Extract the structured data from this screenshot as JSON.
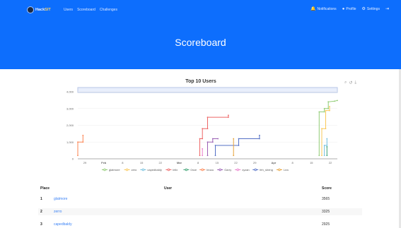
{
  "nav": {
    "brand_main": "Hack",
    "brand_accent": "SIT",
    "links": [
      "Users",
      "Scoreboard",
      "Challenges"
    ],
    "right": [
      {
        "label": "Notifications",
        "icon": "bell-icon"
      },
      {
        "label": "Profile",
        "icon": "user-circle-icon"
      },
      {
        "label": "Settings",
        "icon": "gears-icon"
      },
      {
        "label": "",
        "icon": "logout-icon"
      }
    ]
  },
  "page_title": "Scoreboard",
  "colors": {
    "header_bg": "#0d6efd",
    "link": "#3b82f6"
  },
  "chart_data": {
    "type": "line",
    "title": "Top 10 Users",
    "x_tick_labels": [
      "29",
      "Feb",
      "8",
      "15",
      "22",
      "Mar",
      "8",
      "15",
      "22",
      "29",
      "Apr",
      "8",
      "15",
      "22"
    ],
    "y_tick_labels": [
      "0",
      "1,000",
      "2,000",
      "3,000",
      "4,000"
    ],
    "ylim": [
      0,
      4000
    ],
    "legend_position": "bottom",
    "series": [
      {
        "name": "glatmore",
        "color": "#91cc75",
        "points": [
          [
            0.953,
            0.1
          ],
          [
            0.955,
            0.3
          ],
          [
            0.957,
            0.55
          ],
          [
            0.96,
            0.73
          ],
          [
            0.966,
            0.8
          ],
          [
            0.985,
            0.8
          ],
          [
            0.99,
            0.83
          ],
          [
            1.01,
            0.88
          ],
          [
            1.04,
            0.88
          ]
        ]
      },
      {
        "name": "zero",
        "color": "#fac858",
        "points": [
          [
            0.953,
            0.05
          ],
          [
            0.955,
            0.27
          ],
          [
            0.957,
            0.45
          ],
          [
            0.96,
            0.6
          ],
          [
            0.962,
            0.66
          ]
        ]
      },
      {
        "name": "capedbaldy",
        "color": "#73c0de",
        "points": [
          [
            0.953,
            0.05
          ],
          [
            0.955,
            0.16
          ],
          [
            0.957,
            0.25
          ],
          [
            0.96,
            0.32
          ],
          [
            0.962,
            0.35
          ]
        ]
      },
      {
        "name": "lelix",
        "color": "#ee6666",
        "points": [
          [
            0.953,
            0.05
          ],
          [
            0.955,
            0.18
          ],
          [
            0.957,
            0.29
          ],
          [
            0.96,
            0.33
          ],
          [
            0.962,
            0.34
          ]
        ]
      },
      {
        "name": "0nce",
        "color": "#3ba272",
        "points": [
          [
            0.953,
            0.05
          ],
          [
            0.955,
            0.1
          ],
          [
            0.957,
            0.15
          ]
        ]
      },
      {
        "name": "brucu",
        "color": "#fc8452",
        "points": [
          [
            0.953,
            0.05
          ],
          [
            0.955,
            0.14
          ],
          [
            0.957,
            0.18
          ]
        ]
      },
      {
        "name": "Garry",
        "color": "#9a60b4",
        "points": [
          [
            0.953,
            0.05
          ],
          [
            0.955,
            0.08
          ],
          [
            0.957,
            0.1
          ]
        ]
      },
      {
        "name": "xyzan",
        "color": "#ea7ccc",
        "points": [
          [
            0.953,
            0.05
          ],
          [
            0.955,
            0.12
          ],
          [
            0.957,
            0.14
          ]
        ]
      },
      {
        "name": "feh_sheng",
        "color": "#5470c6",
        "points": [
          [
            0.953,
            0.05
          ],
          [
            0.955,
            0.07
          ],
          [
            0.957,
            0.09
          ]
        ]
      },
      {
        "name": "Lea",
        "color": "#e6a23c",
        "points": [
          [
            0.953,
            0.05
          ],
          [
            0.955,
            0.06
          ],
          [
            0.957,
            0.07
          ]
        ]
      }
    ]
  },
  "table": {
    "headers": [
      "Place",
      "User",
      "Score"
    ],
    "rows": [
      {
        "place": "1",
        "user": "glatmore",
        "score": "3565"
      },
      {
        "place": "2",
        "user": "zerro",
        "score": "3325"
      },
      {
        "place": "3",
        "user": "capedbaldy",
        "score": "2925"
      }
    ]
  }
}
